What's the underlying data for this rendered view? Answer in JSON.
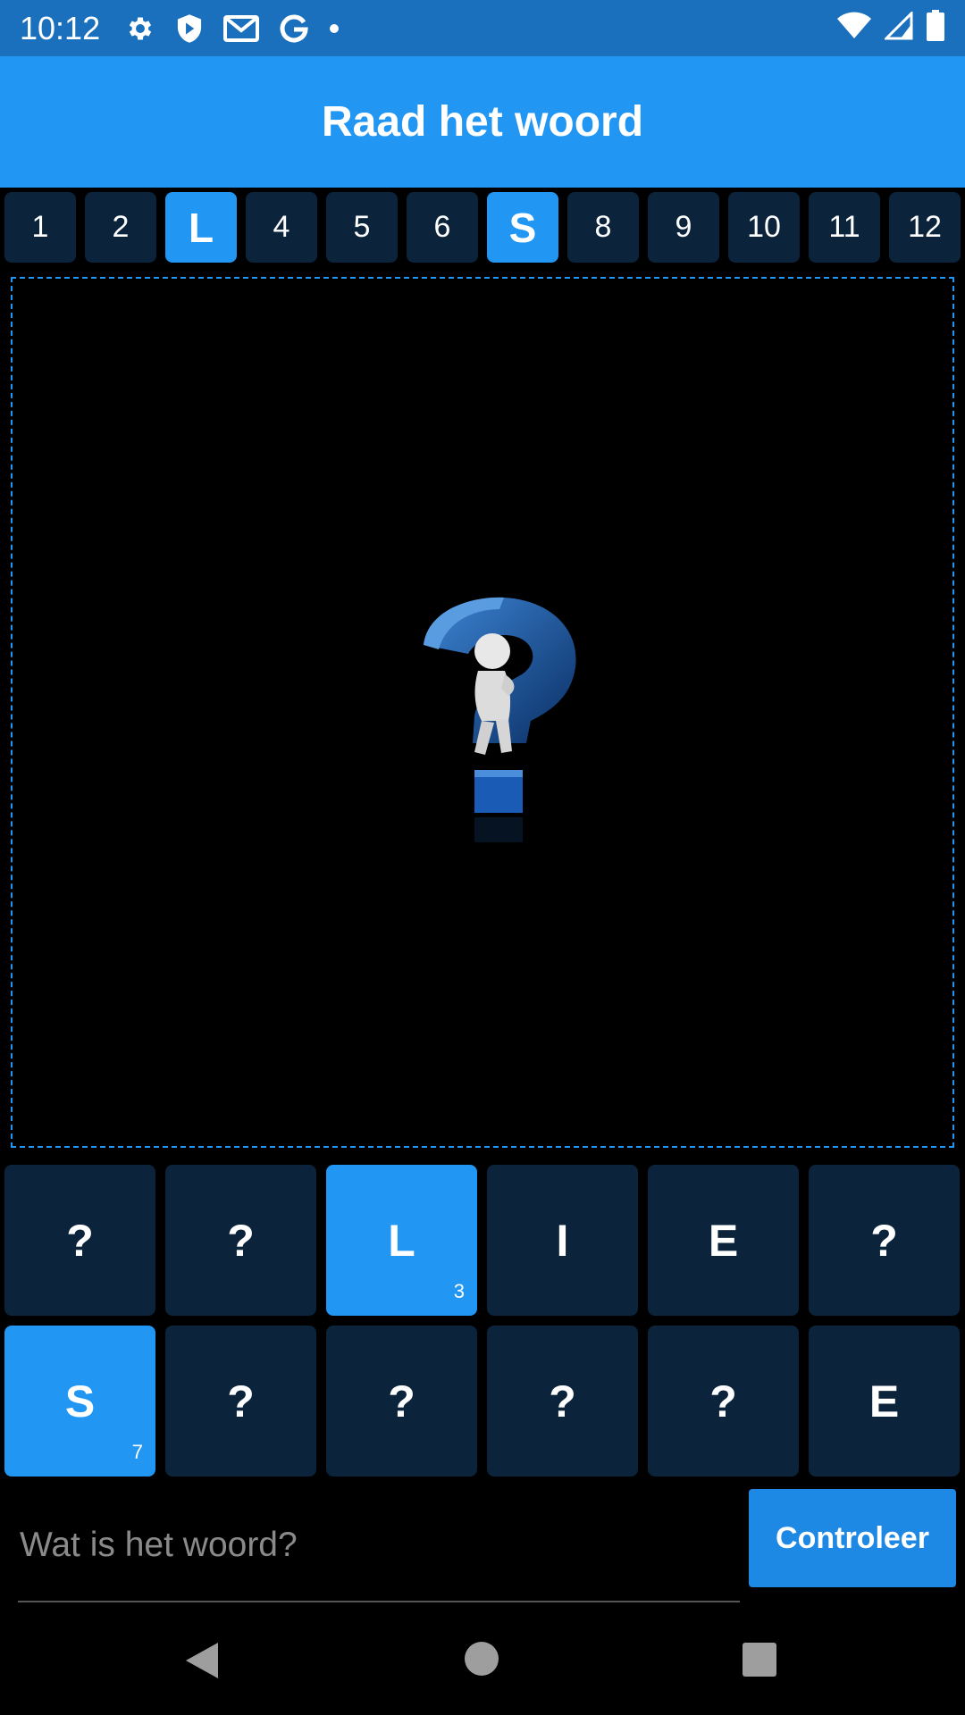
{
  "status_bar": {
    "time": "10:12",
    "icons": [
      "gear-icon",
      "shield-icon",
      "gmail-icon",
      "google-icon",
      "dot-icon",
      "wifi-icon",
      "signal-icon",
      "battery-icon"
    ]
  },
  "app_bar": {
    "title": "Raad het woord"
  },
  "numbers": [
    {
      "label": "1",
      "revealed": false
    },
    {
      "label": "2",
      "revealed": false
    },
    {
      "label": "L",
      "revealed": true
    },
    {
      "label": "4",
      "revealed": false
    },
    {
      "label": "5",
      "revealed": false
    },
    {
      "label": "6",
      "revealed": false
    },
    {
      "label": "S",
      "revealed": true
    },
    {
      "label": "8",
      "revealed": false
    },
    {
      "label": "9",
      "revealed": false
    },
    {
      "label": "10",
      "revealed": false
    },
    {
      "label": "11",
      "revealed": false
    },
    {
      "label": "12",
      "revealed": false
    }
  ],
  "image": {
    "icon": "question-mark-thinking-figure-icon"
  },
  "letters": [
    {
      "char": "?",
      "revealed": false,
      "position": ""
    },
    {
      "char": "?",
      "revealed": false,
      "position": ""
    },
    {
      "char": "L",
      "revealed": true,
      "position": "3"
    },
    {
      "char": "I",
      "revealed": false,
      "position": ""
    },
    {
      "char": "E",
      "revealed": false,
      "position": ""
    },
    {
      "char": "?",
      "revealed": false,
      "position": ""
    },
    {
      "char": "S",
      "revealed": true,
      "position": "7"
    },
    {
      "char": "?",
      "revealed": false,
      "position": ""
    },
    {
      "char": "?",
      "revealed": false,
      "position": ""
    },
    {
      "char": "?",
      "revealed": false,
      "position": ""
    },
    {
      "char": "?",
      "revealed": false,
      "position": ""
    },
    {
      "char": "E",
      "revealed": false,
      "position": ""
    }
  ],
  "answer": {
    "placeholder": "Wat is het woord?",
    "value": "",
    "button_label": "Controleer"
  },
  "colors": {
    "status_bar": "#1a70bd",
    "app_bar": "#2196f3",
    "tile": "#0b233b",
    "tile_revealed": "#2196f3",
    "button": "#1e88e5"
  }
}
